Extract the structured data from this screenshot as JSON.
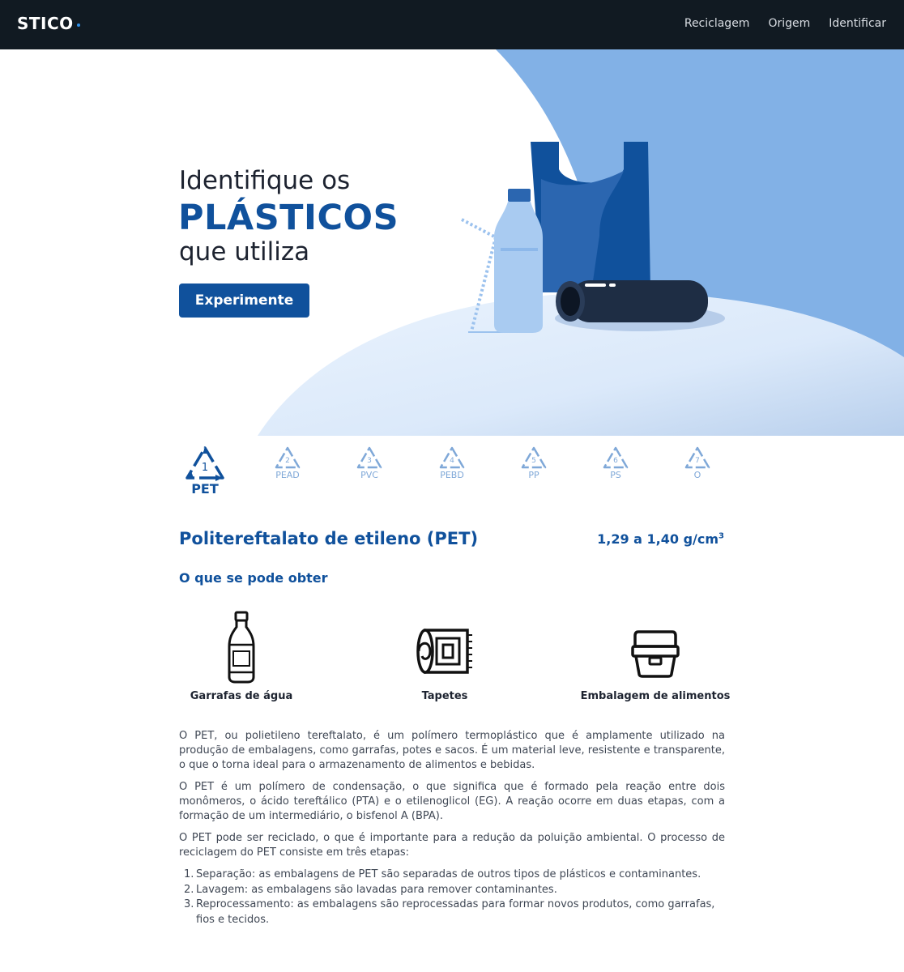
{
  "nav": {
    "logo": "STICO",
    "links": [
      "Reciclagem",
      "Origem",
      "Identificar"
    ]
  },
  "hero": {
    "line1": "Identifique os",
    "line2": "PLÁSTICOS",
    "line3": "que utiliza",
    "cta": "Experimente"
  },
  "tabs": [
    {
      "number": "1",
      "code": "PET"
    },
    {
      "number": "2",
      "code": "PEAD"
    },
    {
      "number": "3",
      "code": "PVC"
    },
    {
      "number": "4",
      "code": "PEBD"
    },
    {
      "number": "5",
      "code": "PP"
    },
    {
      "number": "6",
      "code": "PS"
    },
    {
      "number": "7",
      "code": "O"
    }
  ],
  "material": {
    "title": "Politereftalato de etileno (PET)",
    "density": "1,29 a 1,40 g/cm",
    "density_sup": "3"
  },
  "obtain": {
    "title": "O que se pode obter",
    "products": [
      {
        "label": "Garrafas de água",
        "icon": "water-bottle-icon"
      },
      {
        "label": "Tapetes",
        "icon": "carpet-roll-icon"
      },
      {
        "label": "Embalagem de alimentos",
        "icon": "food-container-icon"
      }
    ]
  },
  "description": {
    "p1": "O PET, ou polietileno tereftalato, é um polímero termoplástico que é amplamente utilizado na produção de embalagens, como garrafas, potes e sacos. É um material leve, resistente e transparente, o que o torna ideal para o armazenamento de alimentos e bebidas.",
    "p2": "O PET é um polímero de condensação, o que significa que é formado pela reação entre dois monômeros, o ácido tereftálico (PTA) e o etilenoglicol (EG). A reação ocorre em duas etapas, com a formação de um intermediário, o bisfenol A (BPA).",
    "p3": "O PET pode ser reciclado, o que é importante para a redução da poluição ambiental. O processo de reciclagem do PET consiste em três etapas:",
    "steps": [
      {
        "num": "1.",
        "text": "Separação: as embalagens de PET são separadas de outros tipos de plásticos e contaminantes."
      },
      {
        "num": "2.",
        "text": "Lavagem: as embalagens são lavadas para remover contaminantes."
      },
      {
        "num": "3.",
        "text": "Reprocessamento: as embalagens são reprocessadas para formar novos produtos, como garrafas, fios e tecidos."
      }
    ]
  },
  "colors": {
    "nav_bg": "#111a22",
    "accent": "#10519c",
    "hero_blue": "#82b1e6",
    "tab_inactive": "#7fa8d8"
  }
}
